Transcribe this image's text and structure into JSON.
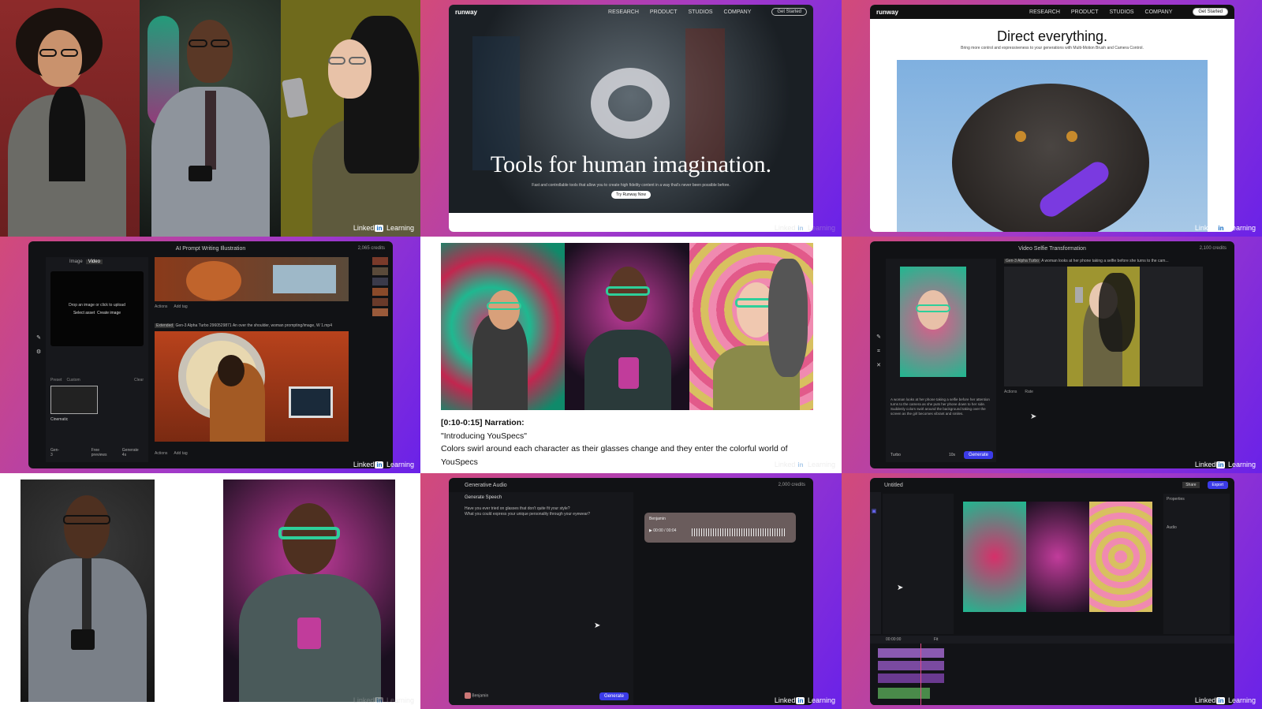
{
  "watermark": {
    "brand_pre": "Linked",
    "brand_in": "in",
    "brand_post": "Learning"
  },
  "panel2": {
    "brand": "runway",
    "nav": [
      "RESEARCH",
      "PRODUCT",
      "STUDIOS",
      "COMPANY"
    ],
    "cta": "Get Started",
    "hero_title": "Tools for human imagination.",
    "hero_sub": "Fast and controllable tools that allow you to create high fidelity content in a way that's never been possible before.",
    "hero_button": "Try Runway Now"
  },
  "panel3": {
    "brand": "runway",
    "nav": [
      "RESEARCH",
      "PRODUCT",
      "STUDIOS",
      "COMPANY"
    ],
    "cta": "Get Started",
    "title": "Direct everything.",
    "subtitle": "Bring more control and expressiveness to your generations with Multi-Motion Brush and Camera Control."
  },
  "panel4": {
    "title": "AI Prompt Writing Illustration",
    "credits": "2,065 credits",
    "tabs": [
      "Image",
      "Video"
    ],
    "dropzone": "Drop an image or click to upload",
    "select_asset": "Select asset",
    "create_image": "Create image",
    "actions": "Actions",
    "add_tag": "Add tag",
    "prompt_tag": "Extended",
    "prompt_text": "Gen-3 Alpha Turbo 2960529871 An over the shoulder, woman prompting/image, W 1.mp4",
    "preset_label": "Preset",
    "custom_label": "Custom",
    "clear": "Clear",
    "cinematic": "Cinematic",
    "model": "Gen-3",
    "free_previews": "Free previews",
    "generate": "Generate 4s"
  },
  "panel5": {
    "head": "[0:10-0:15] Narration:",
    "quote": "\"Introducing YouSpecs\"",
    "body": "Colors swirl around each character as their glasses change and they enter the colorful world of YouSpecs"
  },
  "panel6": {
    "title": "Video Selfie Transformation",
    "credits": "2,100 credits",
    "prompt_left": "A woman looks at her phone taking a selfie before her attention turns to the camera as she puts her phone down to her side. Suddenly colors swirl around the background taking over the screen as the girl becomes vibrant and smiles.",
    "model": "Gen-3 Alpha Turbo",
    "top_prompt": "A woman looks at her phone taking a selfie before she turns to the cam...",
    "actions": "Actions",
    "rate": "Rate",
    "turbo": "Turbo",
    "duration": "10s",
    "generate": "Generate"
  },
  "panel8": {
    "title": "Generative Audio",
    "credits": "2,000 credits",
    "tool": "Generate Speech",
    "script_line1": "Have you ever tried on glasses that don't quite fit your style?",
    "script_line2": "What you could express your unique personality through your eyewear?",
    "voice": "Benjamin",
    "time": "00:00 / 00:04",
    "generate": "Generate"
  },
  "panel9": {
    "title": "Untitled",
    "share": "Share",
    "export": "Export",
    "properties": "Properties",
    "audio": "Audio",
    "zoom": "Fit",
    "time": "00:00:00"
  },
  "colors": {
    "accent_blue": "#3b3be8",
    "gradient_pink": "#d24a7a",
    "gradient_purple": "#6a22e8",
    "green_glasses": "#2ecf9a"
  }
}
